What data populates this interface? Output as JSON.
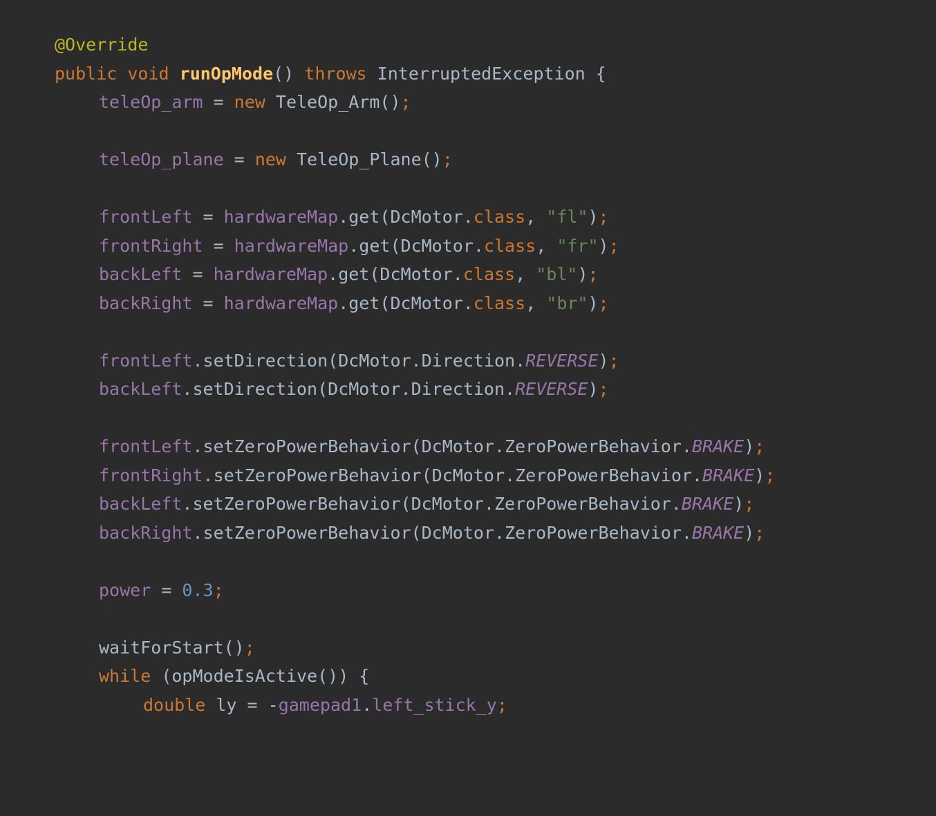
{
  "editor": {
    "background": "#2b2b2b",
    "language": "java",
    "font_size_px": 25,
    "line_height_px": 41.5,
    "indent_size_px": 64
  },
  "colors": {
    "annotation": "#bbb529",
    "keyword": "#cc7832",
    "method_declaration": "#ffc66d",
    "type": "#a9b7c6",
    "plain": "#a9b7c6",
    "field": "#9876aa",
    "string": "#6a8759",
    "number": "#6897bb",
    "static_final": "#9876aa",
    "semicolon": "#cc7832",
    "background": "#2b2b2b"
  },
  "code": {
    "plain_text": "@Override\npublic void runOpMode() throws InterruptedException {\n    teleOp_arm = new TeleOp_Arm();\n\n    teleOp_plane = new TeleOp_Plane();\n\n    frontLeft = hardwareMap.get(DcMotor.class, \"fl\");\n    frontRight = hardwareMap.get(DcMotor.class, \"fr\");\n    backLeft = hardwareMap.get(DcMotor.class, \"bl\");\n    backRight = hardwareMap.get(DcMotor.class, \"br\");\n\n    frontLeft.setDirection(DcMotor.Direction.REVERSE);\n    backLeft.setDirection(DcMotor.Direction.REVERSE);\n\n    frontLeft.setZeroPowerBehavior(DcMotor.ZeroPowerBehavior.BRAKE);\n    frontRight.setZeroPowerBehavior(DcMotor.ZeroPowerBehavior.BRAKE);\n    backLeft.setZeroPowerBehavior(DcMotor.ZeroPowerBehavior.BRAKE);\n    backRight.setZeroPowerBehavior(DcMotor.ZeroPowerBehavior.BRAKE);\n\n    power = 0.3;\n\n    waitForStart();\n    while (opModeIsActive()) {\n        double ly = -gamepad1.left_stick_y;",
    "lines": [
      {
        "indent": 0,
        "tokens": [
          {
            "t": "@Override",
            "c": "annotation"
          }
        ]
      },
      {
        "indent": 0,
        "tokens": [
          {
            "t": "public",
            "c": "keyword"
          },
          {
            "t": " ",
            "c": "plain"
          },
          {
            "t": "void",
            "c": "keyword"
          },
          {
            "t": " ",
            "c": "plain"
          },
          {
            "t": "runOpMode",
            "c": "method"
          },
          {
            "t": "()",
            "c": "punct"
          },
          {
            "t": " ",
            "c": "plain"
          },
          {
            "t": "throws",
            "c": "keyword"
          },
          {
            "t": " ",
            "c": "plain"
          },
          {
            "t": "InterruptedException",
            "c": "type"
          },
          {
            "t": " {",
            "c": "punct"
          }
        ]
      },
      {
        "indent": 1,
        "tokens": [
          {
            "t": "teleOp_arm",
            "c": "field"
          },
          {
            "t": " = ",
            "c": "punct"
          },
          {
            "t": "new",
            "c": "keyword"
          },
          {
            "t": " ",
            "c": "plain"
          },
          {
            "t": "TeleOp_Arm",
            "c": "type"
          },
          {
            "t": "()",
            "c": "punct"
          },
          {
            "t": ";",
            "c": "semi"
          }
        ]
      },
      {
        "indent": 0,
        "tokens": []
      },
      {
        "indent": 1,
        "tokens": [
          {
            "t": "teleOp_plane",
            "c": "field"
          },
          {
            "t": " = ",
            "c": "punct"
          },
          {
            "t": "new",
            "c": "keyword"
          },
          {
            "t": " ",
            "c": "plain"
          },
          {
            "t": "TeleOp_Plane",
            "c": "type"
          },
          {
            "t": "()",
            "c": "punct"
          },
          {
            "t": ";",
            "c": "semi"
          }
        ]
      },
      {
        "indent": 0,
        "tokens": []
      },
      {
        "indent": 1,
        "tokens": [
          {
            "t": "frontLeft",
            "c": "field"
          },
          {
            "t": " = ",
            "c": "punct"
          },
          {
            "t": "hardwareMap",
            "c": "field"
          },
          {
            "t": ".get(",
            "c": "punct"
          },
          {
            "t": "DcMotor",
            "c": "type"
          },
          {
            "t": ".",
            "c": "punct"
          },
          {
            "t": "class",
            "c": "keyword"
          },
          {
            "t": ", ",
            "c": "punct"
          },
          {
            "t": "\"fl\"",
            "c": "string"
          },
          {
            "t": ")",
            "c": "punct"
          },
          {
            "t": ";",
            "c": "semi"
          }
        ]
      },
      {
        "indent": 1,
        "tokens": [
          {
            "t": "frontRight",
            "c": "field"
          },
          {
            "t": " = ",
            "c": "punct"
          },
          {
            "t": "hardwareMap",
            "c": "field"
          },
          {
            "t": ".get(",
            "c": "punct"
          },
          {
            "t": "DcMotor",
            "c": "type"
          },
          {
            "t": ".",
            "c": "punct"
          },
          {
            "t": "class",
            "c": "keyword"
          },
          {
            "t": ", ",
            "c": "punct"
          },
          {
            "t": "\"fr\"",
            "c": "string"
          },
          {
            "t": ")",
            "c": "punct"
          },
          {
            "t": ";",
            "c": "semi"
          }
        ]
      },
      {
        "indent": 1,
        "tokens": [
          {
            "t": "backLeft",
            "c": "field"
          },
          {
            "t": " = ",
            "c": "punct"
          },
          {
            "t": "hardwareMap",
            "c": "field"
          },
          {
            "t": ".get(",
            "c": "punct"
          },
          {
            "t": "DcMotor",
            "c": "type"
          },
          {
            "t": ".",
            "c": "punct"
          },
          {
            "t": "class",
            "c": "keyword"
          },
          {
            "t": ", ",
            "c": "punct"
          },
          {
            "t": "\"bl\"",
            "c": "string"
          },
          {
            "t": ")",
            "c": "punct"
          },
          {
            "t": ";",
            "c": "semi"
          }
        ]
      },
      {
        "indent": 1,
        "tokens": [
          {
            "t": "backRight",
            "c": "field"
          },
          {
            "t": " = ",
            "c": "punct"
          },
          {
            "t": "hardwareMap",
            "c": "field"
          },
          {
            "t": ".get(",
            "c": "punct"
          },
          {
            "t": "DcMotor",
            "c": "type"
          },
          {
            "t": ".",
            "c": "punct"
          },
          {
            "t": "class",
            "c": "keyword"
          },
          {
            "t": ", ",
            "c": "punct"
          },
          {
            "t": "\"br\"",
            "c": "string"
          },
          {
            "t": ")",
            "c": "punct"
          },
          {
            "t": ";",
            "c": "semi"
          }
        ]
      },
      {
        "indent": 0,
        "tokens": []
      },
      {
        "indent": 1,
        "tokens": [
          {
            "t": "frontLeft",
            "c": "field"
          },
          {
            "t": ".setDirection(",
            "c": "punct"
          },
          {
            "t": "DcMotor",
            "c": "type"
          },
          {
            "t": ".",
            "c": "punct"
          },
          {
            "t": "Direction",
            "c": "type"
          },
          {
            "t": ".",
            "c": "punct"
          },
          {
            "t": "REVERSE",
            "c": "static"
          },
          {
            "t": ")",
            "c": "punct"
          },
          {
            "t": ";",
            "c": "semi"
          }
        ]
      },
      {
        "indent": 1,
        "tokens": [
          {
            "t": "backLeft",
            "c": "field"
          },
          {
            "t": ".setDirection(",
            "c": "punct"
          },
          {
            "t": "DcMotor",
            "c": "type"
          },
          {
            "t": ".",
            "c": "punct"
          },
          {
            "t": "Direction",
            "c": "type"
          },
          {
            "t": ".",
            "c": "punct"
          },
          {
            "t": "REVERSE",
            "c": "static"
          },
          {
            "t": ")",
            "c": "punct"
          },
          {
            "t": ";",
            "c": "semi"
          }
        ]
      },
      {
        "indent": 0,
        "tokens": []
      },
      {
        "indent": 1,
        "tokens": [
          {
            "t": "frontLeft",
            "c": "field"
          },
          {
            "t": ".setZeroPowerBehavior(",
            "c": "punct"
          },
          {
            "t": "DcMotor",
            "c": "type"
          },
          {
            "t": ".",
            "c": "punct"
          },
          {
            "t": "ZeroPowerBehavior",
            "c": "type"
          },
          {
            "t": ".",
            "c": "punct"
          },
          {
            "t": "BRAKE",
            "c": "static"
          },
          {
            "t": ")",
            "c": "punct"
          },
          {
            "t": ";",
            "c": "semi"
          }
        ]
      },
      {
        "indent": 1,
        "tokens": [
          {
            "t": "frontRight",
            "c": "field"
          },
          {
            "t": ".setZeroPowerBehavior(",
            "c": "punct"
          },
          {
            "t": "DcMotor",
            "c": "type"
          },
          {
            "t": ".",
            "c": "punct"
          },
          {
            "t": "ZeroPowerBehavior",
            "c": "type"
          },
          {
            "t": ".",
            "c": "punct"
          },
          {
            "t": "BRAKE",
            "c": "static"
          },
          {
            "t": ")",
            "c": "punct"
          },
          {
            "t": ";",
            "c": "semi"
          }
        ]
      },
      {
        "indent": 1,
        "tokens": [
          {
            "t": "backLeft",
            "c": "field"
          },
          {
            "t": ".setZeroPowerBehavior(",
            "c": "punct"
          },
          {
            "t": "DcMotor",
            "c": "type"
          },
          {
            "t": ".",
            "c": "punct"
          },
          {
            "t": "ZeroPowerBehavior",
            "c": "type"
          },
          {
            "t": ".",
            "c": "punct"
          },
          {
            "t": "BRAKE",
            "c": "static"
          },
          {
            "t": ")",
            "c": "punct"
          },
          {
            "t": ";",
            "c": "semi"
          }
        ]
      },
      {
        "indent": 1,
        "tokens": [
          {
            "t": "backRight",
            "c": "field"
          },
          {
            "t": ".setZeroPowerBehavior(",
            "c": "punct"
          },
          {
            "t": "DcMotor",
            "c": "type"
          },
          {
            "t": ".",
            "c": "punct"
          },
          {
            "t": "ZeroPowerBehavior",
            "c": "type"
          },
          {
            "t": ".",
            "c": "punct"
          },
          {
            "t": "BRAKE",
            "c": "static"
          },
          {
            "t": ")",
            "c": "punct"
          },
          {
            "t": ";",
            "c": "semi"
          }
        ]
      },
      {
        "indent": 0,
        "tokens": []
      },
      {
        "indent": 1,
        "tokens": [
          {
            "t": "power",
            "c": "field"
          },
          {
            "t": " = ",
            "c": "punct"
          },
          {
            "t": "0.3",
            "c": "number"
          },
          {
            "t": ";",
            "c": "semi"
          }
        ]
      },
      {
        "indent": 0,
        "tokens": []
      },
      {
        "indent": 1,
        "tokens": [
          {
            "t": "waitForStart",
            "c": "plain"
          },
          {
            "t": "()",
            "c": "punct"
          },
          {
            "t": ";",
            "c": "semi"
          }
        ]
      },
      {
        "indent": 1,
        "tokens": [
          {
            "t": "while",
            "c": "keyword"
          },
          {
            "t": " (",
            "c": "punct"
          },
          {
            "t": "opModeIsActive",
            "c": "plain"
          },
          {
            "t": "())",
            "c": "punct"
          },
          {
            "t": " {",
            "c": "punct"
          }
        ]
      },
      {
        "indent": 2,
        "tokens": [
          {
            "t": "double",
            "c": "keyword"
          },
          {
            "t": " ",
            "c": "plain"
          },
          {
            "t": "ly",
            "c": "plain"
          },
          {
            "t": " = -",
            "c": "punct"
          },
          {
            "t": "gamepad1",
            "c": "field"
          },
          {
            "t": ".",
            "c": "punct"
          },
          {
            "t": "left_stick_y",
            "c": "field"
          },
          {
            "t": ";",
            "c": "semi"
          }
        ]
      }
    ]
  }
}
